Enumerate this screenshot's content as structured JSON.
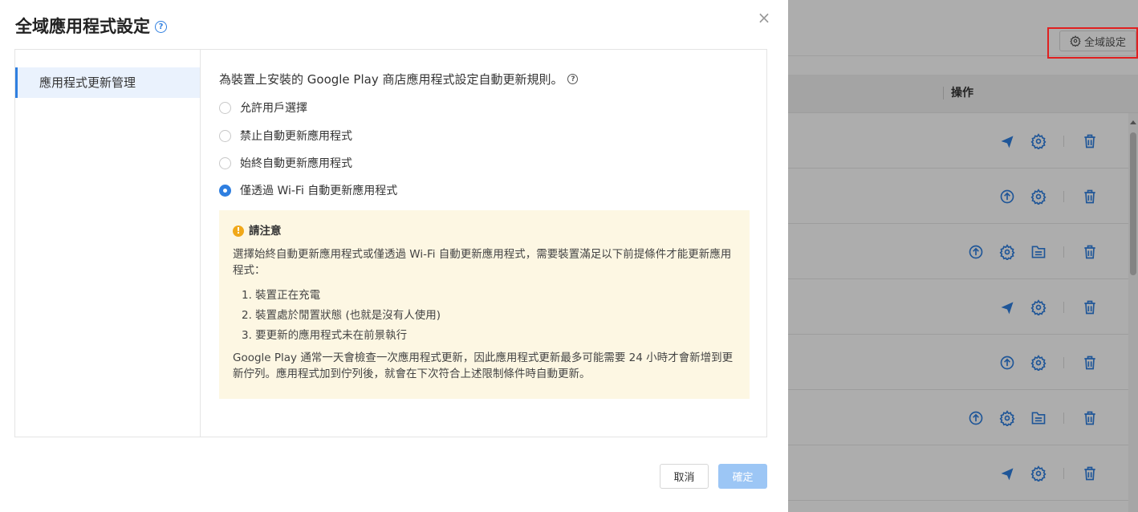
{
  "modal": {
    "title": "全域應用程式設定",
    "title_help_icon": "question-circle-icon",
    "close_icon": "×",
    "nav_items": [
      {
        "label": "應用程式更新管理",
        "selected": true
      }
    ],
    "description": "為裝置上安裝的 Google Play 商店應用程式設定自動更新規則。",
    "description_help_icon": "question-circle-icon",
    "options": [
      {
        "label": "允許用戶選擇",
        "checked": false
      },
      {
        "label": "禁止自動更新應用程式",
        "checked": false
      },
      {
        "label": "始終自動更新應用程式",
        "checked": false
      },
      {
        "label": "僅透過 Wi-Fi 自動更新應用程式",
        "checked": true
      }
    ],
    "notice": {
      "icon": "warning-icon",
      "title": "請注意",
      "paragraph1": "選擇始終自動更新應用程式或僅透過 Wi-Fi 自動更新應用程式，需要裝置滿足以下前提條件才能更新應用程式：",
      "items": [
        "1. 裝置正在充電",
        "2. 裝置處於閒置狀態 (也就是沒有人使用)",
        "3. 要更新的應用程式未在前景執行"
      ],
      "paragraph2": "Google Play 通常一天會檢查一次應用程式更新，因此應用程式更新最多可能需要 24 小時才會新增到更新佇列。應用程式加到佇列後，就會在下次符合上述限制條件時自動更新。"
    },
    "buttons": {
      "cancel": "取消",
      "ok": "確定"
    }
  },
  "background": {
    "global_settings_label": "全域設定",
    "actions_header": "操作",
    "rows": [
      {
        "icons": [
          "send-icon",
          "gear-icon",
          "trash-icon"
        ]
      },
      {
        "icons": [
          "upload-circle-icon",
          "gear-icon",
          "trash-icon"
        ]
      },
      {
        "icons": [
          "upload-circle-icon",
          "gear-icon",
          "folder-sliders-icon",
          "trash-icon"
        ]
      },
      {
        "icons": [
          "send-icon",
          "gear-icon",
          "trash-icon"
        ]
      },
      {
        "icons": [
          "upload-circle-icon",
          "gear-icon",
          "trash-icon"
        ]
      },
      {
        "icons": [
          "upload-circle-icon",
          "gear-icon",
          "folder-sliders-icon",
          "trash-icon"
        ]
      },
      {
        "icons": [
          "send-icon",
          "gear-icon",
          "trash-icon"
        ]
      }
    ]
  },
  "colors": {
    "accent": "#2f7fe0",
    "highlight": "#e02020",
    "notice_bg": "#fdf7e3",
    "warning": "#f0a81a",
    "ok_disabled": "#9cc6f5"
  }
}
